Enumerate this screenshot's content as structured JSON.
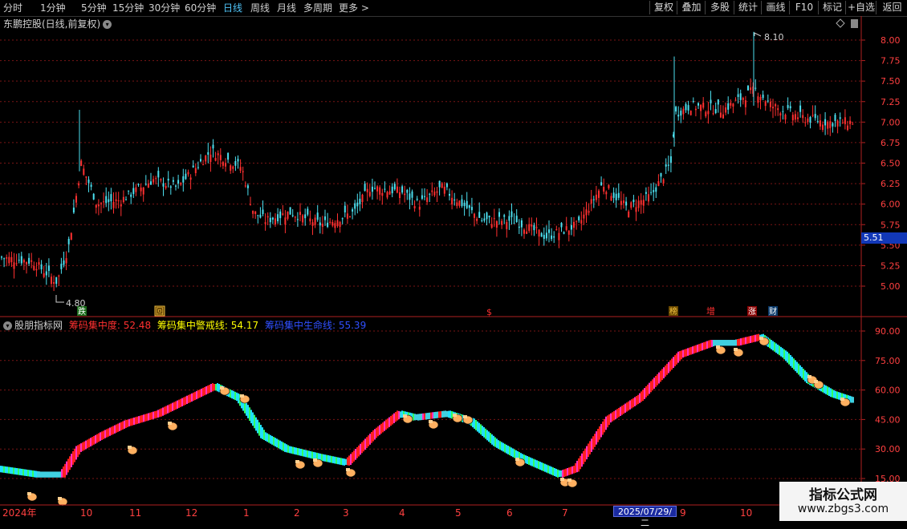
{
  "toolbar": {
    "periods": [
      "分时",
      "1分钟",
      "5分钟",
      "15分钟",
      "30分钟",
      "60分钟",
      "日线",
      "周线",
      "月线",
      "多周期",
      "更多 >"
    ],
    "active_period": "日线",
    "right_buttons": [
      "复权",
      "叠加",
      "多股",
      "统计",
      "画线",
      "F10",
      "标记",
      "+自选",
      "返回"
    ]
  },
  "main_panel": {
    "title": "东鹏控股(日线,前复权)",
    "price_labels": [
      "8.00",
      "7.75",
      "7.50",
      "7.25",
      "7.00",
      "6.75",
      "6.50",
      "6.25",
      "6.00",
      "5.75",
      "5.50",
      "5.25",
      "5.00"
    ],
    "current_price": "5.51",
    "high_label": "8.10",
    "low_label": "4.80",
    "event_markers": [
      "跌",
      "回",
      "$",
      "榜",
      "增",
      "涨",
      "财"
    ]
  },
  "indicator_panel": {
    "source": "股朋指标网",
    "line1_label": "筹码集中度:",
    "line1_value": "52.48",
    "line2_label": "筹码集中警戒线:",
    "line2_value": "54.17",
    "line3_label": "筹码集中生命线:",
    "line3_value": "55.39",
    "axis_labels": [
      "90.00",
      "75.00",
      "60.00",
      "45.00",
      "30.00",
      "15.00"
    ]
  },
  "time_axis": {
    "labels": [
      "2024年",
      "10",
      "11",
      "12",
      "1",
      "2",
      "3",
      "4",
      "5",
      "6",
      "7",
      "2025/07/29/二",
      "9",
      "10"
    ]
  },
  "watermark": {
    "title": "指标公式网",
    "url": "www.zbgs3.com"
  },
  "colors": {
    "up": "#ff3030",
    "down": "#4ce0f0",
    "grid": "#8b1a1a",
    "accent_blue": "#4fc3f7",
    "indicator_red": "#ff3030",
    "indicator_yellow": "#ffff00",
    "indicator_blue": "#3050ff"
  }
}
